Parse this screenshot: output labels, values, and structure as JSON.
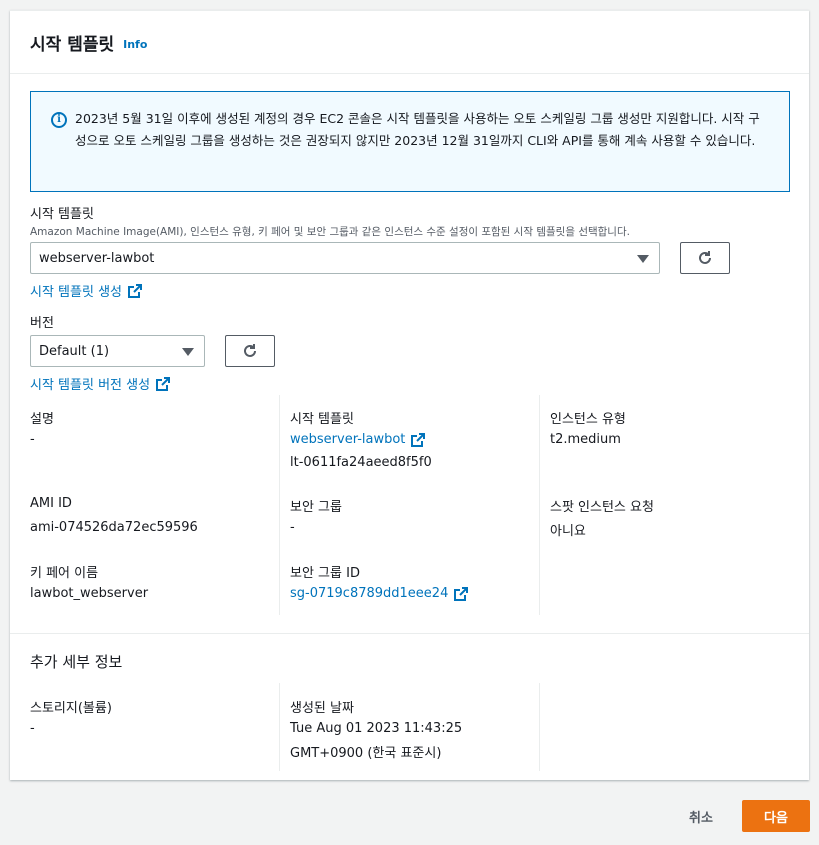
{
  "panel": {
    "title": "시작 템플릿",
    "info_label": "Info"
  },
  "alert": {
    "icon": "info-icon",
    "text": "2023년 5월 31일 이후에 생성된 계정의 경우 EC2 콘솔은 시작 템플릿을 사용하는 오토 스케일링 그룹 생성만 지원합니다. 시작 구성으로 오토 스케일링 그룹을 생성하는 것은 권장되지 않지만 2023년 12월 31일까지 CLI와 API를 통해 계속 사용할 수 있습니다."
  },
  "template_field": {
    "label": "시작 템플릿",
    "description": "Amazon Machine Image(AMI), 인스턴스 유형, 키 페어 및 보안 그룹과 같은 인스턴스 수준 설정이 포함된 시작 템플릿을 선택합니다.",
    "selected": "webserver-lawbot",
    "create_link": "시작 템플릿 생성"
  },
  "version_field": {
    "label": "버전",
    "selected": "Default (1)",
    "create_link": "시작 템플릿 버전 생성"
  },
  "details": {
    "description_label": "설명",
    "description_value": "-",
    "template_label": "시작 템플릿",
    "template_name": "webserver-lawbot",
    "template_id": "lt-0611fa24aeed8f5f0",
    "instance_type_label": "인스턴스 유형",
    "instance_type_value": "t2.medium",
    "ami_label": "AMI ID",
    "ami_value": "ami-074526da72ec59596",
    "security_group_label": "보안 그룹",
    "security_group_value": "-",
    "spot_label": "스팟 인스턴스 요청",
    "spot_value": "아니요",
    "key_pair_label": "키 페어 이름",
    "key_pair_value": "lawbot_webserver",
    "security_group_id_label": "보안 그룹 ID",
    "security_group_id_value": "sg-0719c8789dd1eee24"
  },
  "additional": {
    "title": "추가 세부 정보",
    "storage_label": "스토리지(볼륨)",
    "storage_value": "-",
    "created_label": "생성된 날짜",
    "created_line1": "Tue Aug 01 2023 11:43:25",
    "created_line2": "GMT+0900 (한국 표준시)"
  },
  "footer": {
    "cancel_label": "취소",
    "next_label": "다음"
  },
  "colors": {
    "link": "#0073bb",
    "primary_button": "#ec7211",
    "alert_bg": "#f1faff"
  }
}
